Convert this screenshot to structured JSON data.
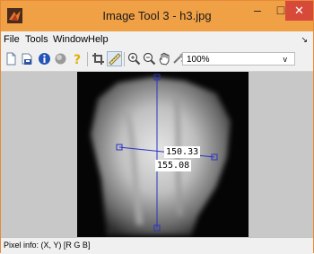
{
  "window": {
    "title": "Image Tool 3 - h3.jpg",
    "min_glyph": "–",
    "max_glyph": "□",
    "close_glyph": "✕",
    "accent_color": "#f0a045",
    "close_color": "#d74a3a"
  },
  "menubar": {
    "items": [
      "File",
      "Tools",
      "Window",
      "Help"
    ],
    "dock_glyph": "↘"
  },
  "toolbar": {
    "icons": [
      "new-figure-icon",
      "save-icon",
      "info-icon",
      "color-info-icon",
      "help-icon",
      "crop-icon",
      "measure-distance-icon",
      "zoom-in-icon",
      "zoom-out-icon",
      "pan-icon",
      "adjust-contrast-icon"
    ],
    "zoom_value": "100%",
    "zoom_arrow": "v"
  },
  "measurements": {
    "horizontal": "150.33",
    "vertical": "155.08"
  },
  "status": {
    "pixel_info": "Pixel info: (X, Y)  [R G B]"
  }
}
